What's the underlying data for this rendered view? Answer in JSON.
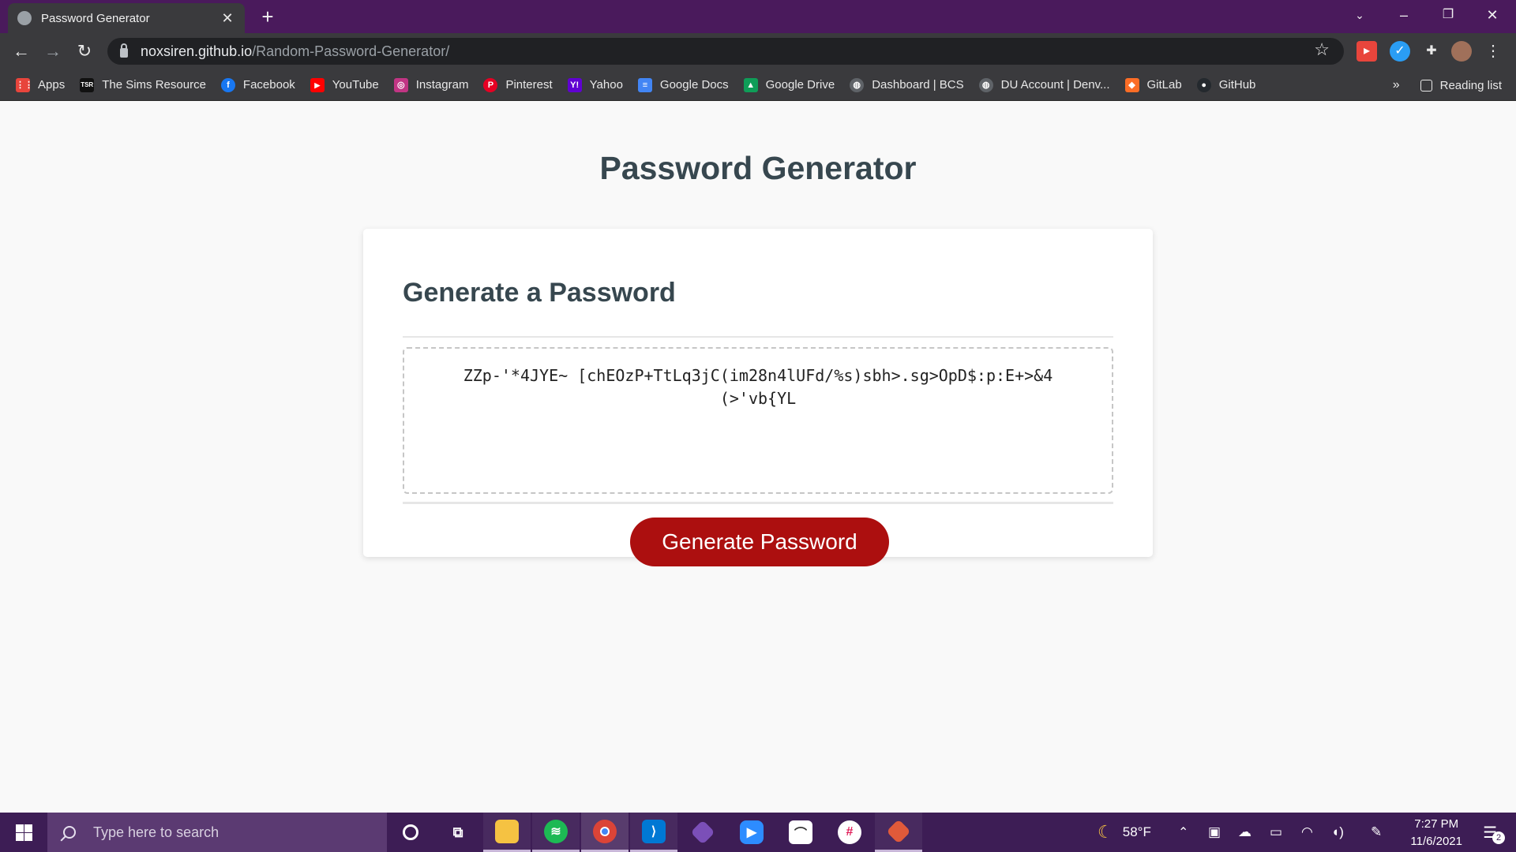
{
  "browser": {
    "tab_title": "Password Generator",
    "tab_close": "✕",
    "new_tab": "+",
    "url_host": "noxsiren.github.io",
    "url_path": "/Random-Password-Generator/",
    "bookmarks": [
      {
        "label": "Apps",
        "icon": "apps-grid-icon",
        "color": "#e8453c"
      },
      {
        "label": "The Sims Resource",
        "icon": "tsr-icon",
        "color": "#111111"
      },
      {
        "label": "Facebook",
        "icon": "facebook-icon",
        "color": "#1877f2"
      },
      {
        "label": "YouTube",
        "icon": "youtube-icon",
        "color": "#ff0000"
      },
      {
        "label": "Instagram",
        "icon": "instagram-icon",
        "color": "#c13584"
      },
      {
        "label": "Pinterest",
        "icon": "pinterest-icon",
        "color": "#e60023"
      },
      {
        "label": "Yahoo",
        "icon": "yahoo-icon",
        "color": "#6001d2"
      },
      {
        "label": "Google Docs",
        "icon": "google-docs-icon",
        "color": "#4285f4"
      },
      {
        "label": "Google Drive",
        "icon": "google-drive-icon",
        "color": "#0f9d58"
      },
      {
        "label": "Dashboard | BCS",
        "icon": "globe-icon",
        "color": "#5f6368"
      },
      {
        "label": "DU Account | Denv...",
        "icon": "globe-icon",
        "color": "#5f6368"
      },
      {
        "label": "GitLab",
        "icon": "gitlab-icon",
        "color": "#fc6d26"
      },
      {
        "label": "GitHub",
        "icon": "github-icon",
        "color": "#24292e"
      }
    ],
    "overflow": "»",
    "reading_list": "Reading list"
  },
  "page": {
    "title": "Password Generator",
    "card_header": "Generate a Password",
    "password": "ZZp-'*4JYE~ [chEOzP+TtLq3jC(im28n4lUFd/%s)sbh>.sg>OpD$:p:E+>&4(>'vb{YL",
    "button_label": "Generate Password"
  },
  "taskbar": {
    "search_placeholder": "Type here to search",
    "weather": "58°F",
    "time": "7:27 PM",
    "date": "11/6/2021",
    "notification_count": "2"
  }
}
